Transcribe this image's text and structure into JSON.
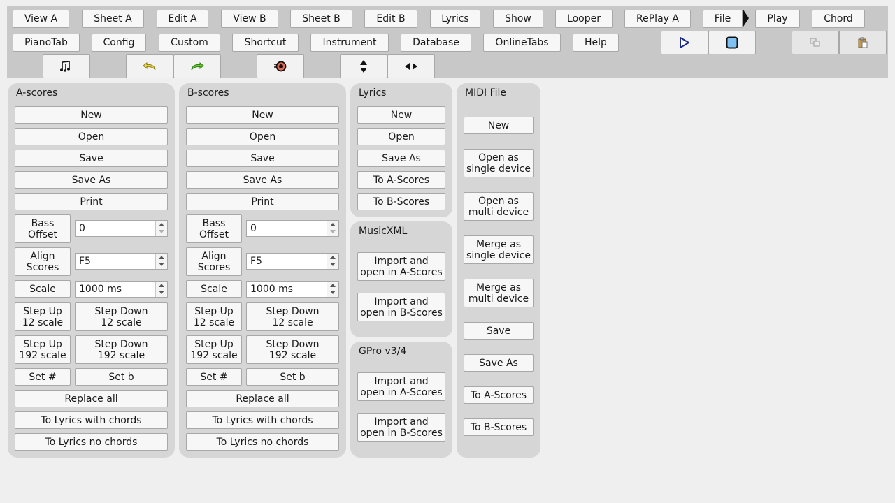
{
  "menu": {
    "row1": [
      "View A",
      "Sheet A",
      "Edit A",
      "View B",
      "Sheet B",
      "Edit B",
      "Lyrics",
      "Show",
      "Looper",
      "RePlay A",
      "File",
      "Play",
      "Chord"
    ],
    "row2": [
      "PianoTab",
      "Config",
      "Custom",
      "Shortcut",
      "Instrument",
      "Database",
      "OnlineTabs",
      "Help"
    ]
  },
  "icons": {
    "play": "play-icon",
    "stop": "stop-icon",
    "copy": "copy-icon",
    "paste": "paste-icon",
    "notes": "music-notes-icon",
    "undo": "undo-icon",
    "redo": "redo-icon",
    "record": "record-icon",
    "vertical_resize": "vertical-resize-icon",
    "horizontal_resize": "horizontal-resize-icon"
  },
  "colors": {
    "play_triangle": "#1a2a8a",
    "stop_fill": "#7ec1f2",
    "undo_arrow": "#e8d84a",
    "redo_arrow": "#6fca3a",
    "record": "#e06a5a"
  },
  "ascores": {
    "title": "A-scores",
    "new": "New",
    "open": "Open",
    "save": "Save",
    "save_as": "Save As",
    "print": "Print",
    "bass_offset": "Bass\nOffset",
    "bass_offset_value": "0",
    "align_scores": "Align\nScores",
    "align_value": "F5",
    "scale": "Scale",
    "scale_value": "1000 ms",
    "step_up_12": "Step Up\n12 scale",
    "step_down_12": "Step Down\n12 scale",
    "step_up_192": "Step Up\n192 scale",
    "step_down_192": "Step Down\n192 scale",
    "set_sharp": "Set #",
    "set_flat": "Set b",
    "replace_all": "Replace all",
    "to_lyrics_chords": "To Lyrics with chords",
    "to_lyrics_no_chords": "To Lyrics no chords"
  },
  "bscores": {
    "title": "B-scores",
    "new": "New",
    "open": "Open",
    "save": "Save",
    "save_as": "Save As",
    "print": "Print",
    "bass_offset": "Bass\nOffset",
    "bass_offset_value": "0",
    "align_scores": "Align\nScores",
    "align_value": "F5",
    "scale": "Scale",
    "scale_value": "1000 ms",
    "step_up_12": "Step Up\n12 scale",
    "step_down_12": "Step Down\n12 scale",
    "step_up_192": "Step Up\n192 scale",
    "step_down_192": "Step Down\n192 scale",
    "set_sharp": "Set #",
    "set_flat": "Set b",
    "replace_all": "Replace all",
    "to_lyrics_chords": "To Lyrics with chords",
    "to_lyrics_no_chords": "To Lyrics no chords"
  },
  "lyrics": {
    "title": "Lyrics",
    "new": "New",
    "open": "Open",
    "save_as": "Save As",
    "to_ascores": "To A-Scores",
    "to_bscores": "To B-Scores"
  },
  "musicxml": {
    "title": "MusicXML",
    "import_a": "Import and\nopen in A-Scores",
    "import_b": "Import and\nopen in B-Scores"
  },
  "gpro": {
    "title": "GPro v3/4",
    "import_a": "Import and\nopen in A-Scores",
    "import_b": "Import and\nopen in B-Scores"
  },
  "midi": {
    "title": "MIDI File",
    "new": "New",
    "open_single": "Open as\nsingle device",
    "open_multi": "Open as\nmulti device",
    "merge_single": "Merge as\nsingle device",
    "merge_multi": "Merge as\nmulti device",
    "save": "Save",
    "save_as": "Save As",
    "to_ascores": "To A-Scores",
    "to_bscores": "To B-Scores"
  }
}
